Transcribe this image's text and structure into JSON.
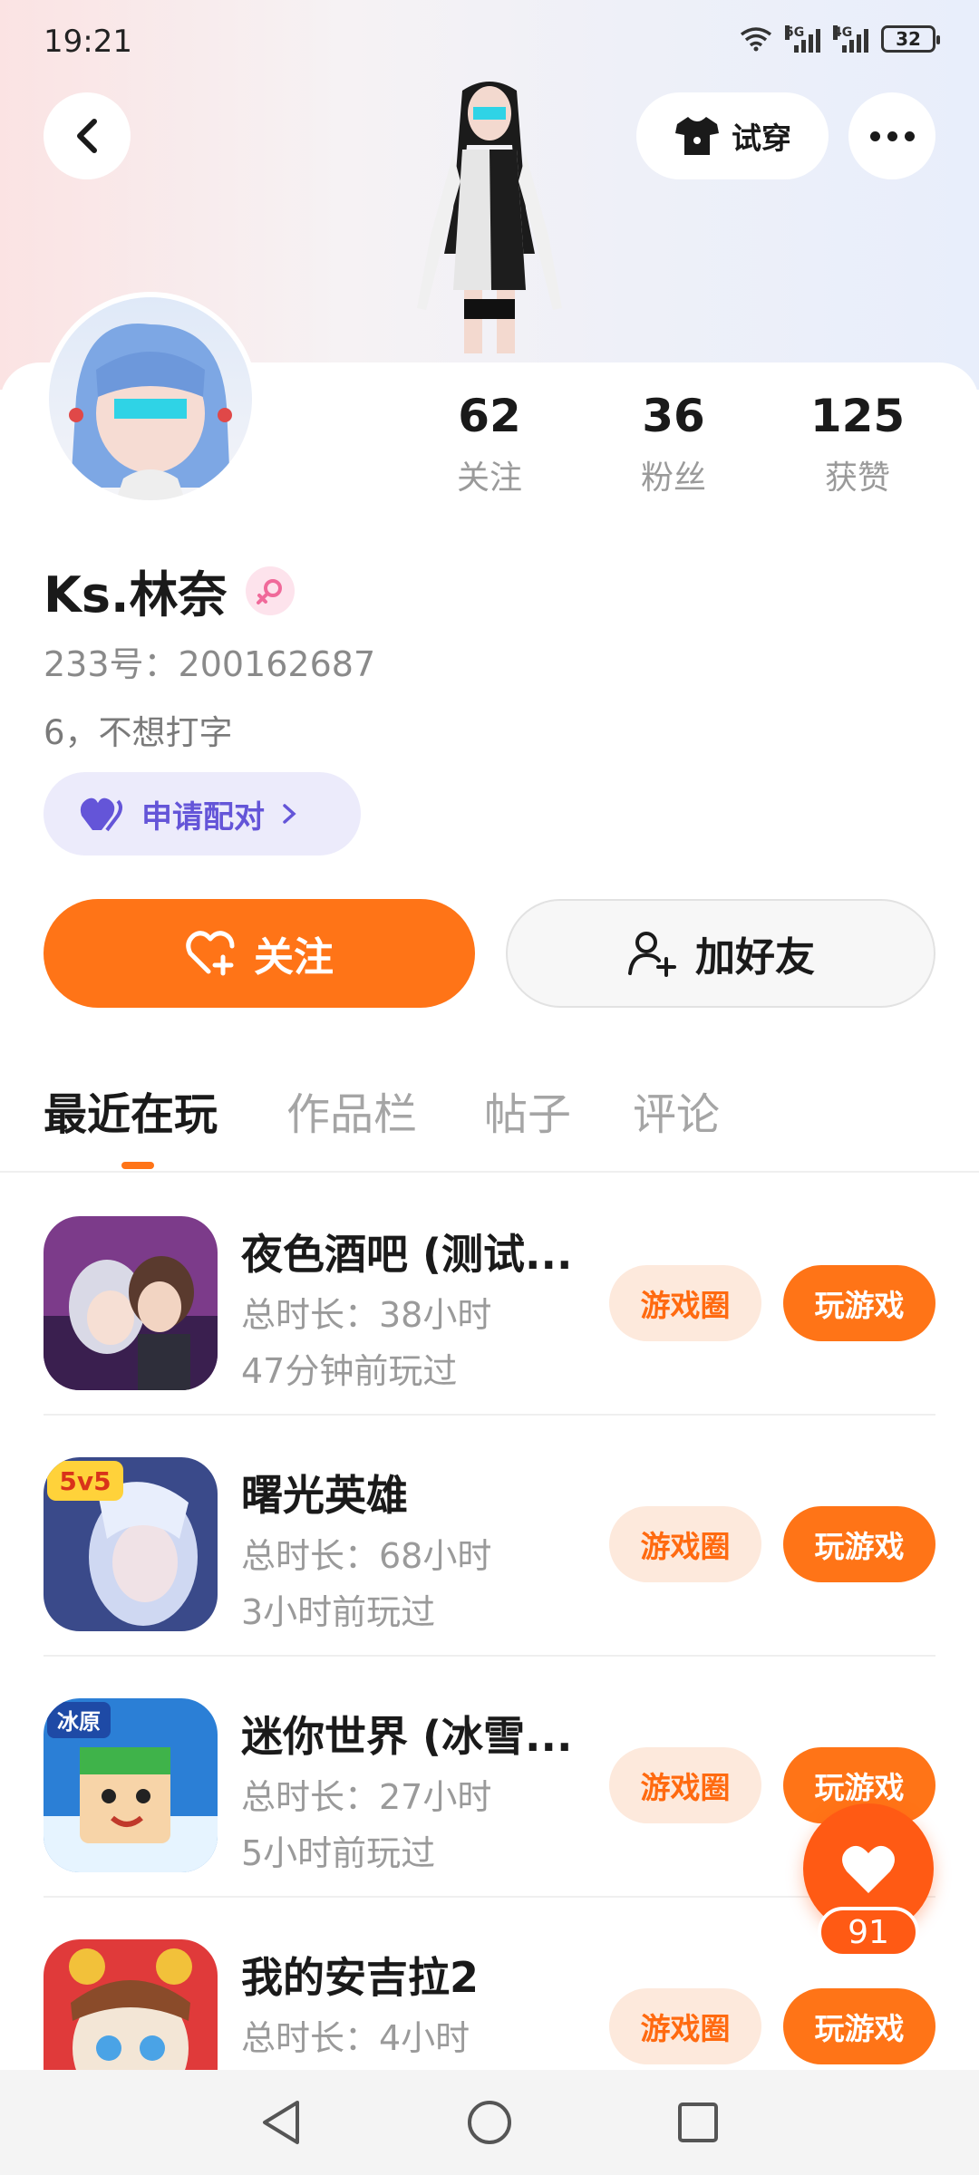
{
  "status_bar": {
    "time": "19:21",
    "network_1": "5G",
    "network_2": "4G",
    "battery": "32"
  },
  "header": {
    "try_on_label": "试穿"
  },
  "profile": {
    "name": "Ks.林奈",
    "uid": "233号：200162687",
    "bio": "6，不想打字",
    "pair_label": "申请配对"
  },
  "stats": [
    {
      "value": "62",
      "label": "关注"
    },
    {
      "value": "36",
      "label": "粉丝"
    },
    {
      "value": "125",
      "label": "获赞"
    }
  ],
  "actions": {
    "follow_label": "关注",
    "add_friend_label": "加好友"
  },
  "tabs": [
    {
      "label": "最近在玩",
      "active": true
    },
    {
      "label": "作品栏",
      "active": false
    },
    {
      "label": "帖子",
      "active": false
    },
    {
      "label": "评论",
      "active": false
    }
  ],
  "games": [
    {
      "title": "夜色酒吧 (测试...",
      "total": "总时长：38小时",
      "last": "47分钟前玩过",
      "circle": "游戏圈",
      "play": "玩游戏"
    },
    {
      "title": "曙光英雄",
      "total": "总时长：68小时",
      "last": "3小时前玩过",
      "circle": "游戏圈",
      "play": "玩游戏",
      "badge": "5v5"
    },
    {
      "title": "迷你世界 (冰雪...",
      "total": "总时长：27小时",
      "last": "5小时前玩过",
      "circle": "游戏圈",
      "play": "玩游戏",
      "badge": "冰原"
    },
    {
      "title": "我的安吉拉2",
      "total": "总时长：4小时",
      "last": "",
      "circle": "游戏圈",
      "play": "玩游戏"
    }
  ],
  "like_fab": {
    "count": "91"
  },
  "colors": {
    "accent": "#ff7417",
    "pair": "#6455d8",
    "fab": "#ff5a14"
  }
}
